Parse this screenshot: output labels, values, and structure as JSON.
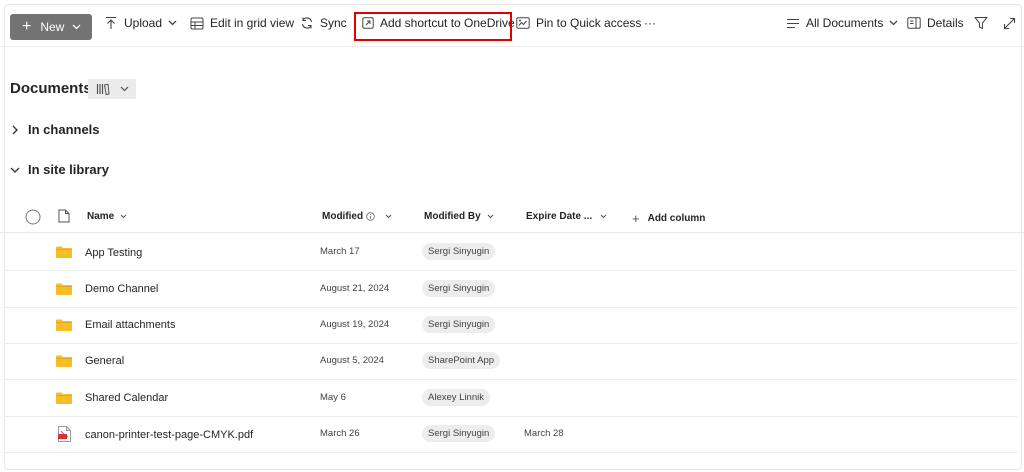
{
  "toolbar": {
    "new_label": "New",
    "upload_label": "Upload",
    "edit_grid_label": "Edit in grid view",
    "sync_label": "Sync",
    "add_shortcut_label": "Add shortcut to OneDrive",
    "pin_label": "Pin to Quick access",
    "more_label": "···",
    "view_label": "All Documents",
    "details_label": "Details"
  },
  "header": {
    "title": "Documents"
  },
  "groups": {
    "channels": "In channels",
    "site_library": "In site library"
  },
  "columns": {
    "name": "Name",
    "modified": "Modified",
    "modified_by": "Modified By",
    "expire_date": "Expire Date ...",
    "add_column": "Add column"
  },
  "rows": [
    {
      "type": "folder",
      "name": "App Testing",
      "modified": "March 17",
      "modified_by": "Sergi Sinyugin",
      "expire": ""
    },
    {
      "type": "folder",
      "name": "Demo Channel",
      "modified": "August 21, 2024",
      "modified_by": "Sergi Sinyugin",
      "expire": ""
    },
    {
      "type": "folder",
      "name": "Email attachments",
      "modified": "August 19, 2024",
      "modified_by": "Sergi Sinyugin",
      "expire": ""
    },
    {
      "type": "folder",
      "name": "General",
      "modified": "August 5, 2024",
      "modified_by": "SharePoint App",
      "expire": ""
    },
    {
      "type": "folder",
      "name": "Shared Calendar",
      "modified": "May 6",
      "modified_by": "Alexey Linnik",
      "expire": ""
    },
    {
      "type": "pdf",
      "name": "canon-printer-test-page-CMYK.pdf",
      "modified": "March 26",
      "modified_by": "Sergi Sinyugin",
      "expire": "March 28"
    }
  ],
  "colors": {
    "new_button": "#737373",
    "highlight_box": "#e00000",
    "folder": "#f5bd28",
    "pdf": "#d13438"
  }
}
